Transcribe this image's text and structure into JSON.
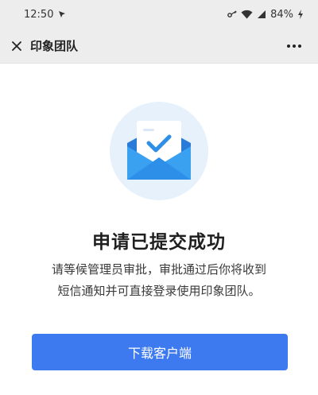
{
  "status_bar": {
    "time": "12:50",
    "battery": "84%"
  },
  "nav": {
    "title": "印象团队"
  },
  "main": {
    "headline": "申请已提交成功",
    "desc_line1": "请等候管理员审批，审批通过后你将收到",
    "desc_line2": "短信通知并可直接登录使用印象团队。",
    "download_button": "下载客户端"
  },
  "colors": {
    "accent": "#3d7af0",
    "envelope": "#2e8fe8",
    "circle_bg": "#e7f1fb"
  }
}
